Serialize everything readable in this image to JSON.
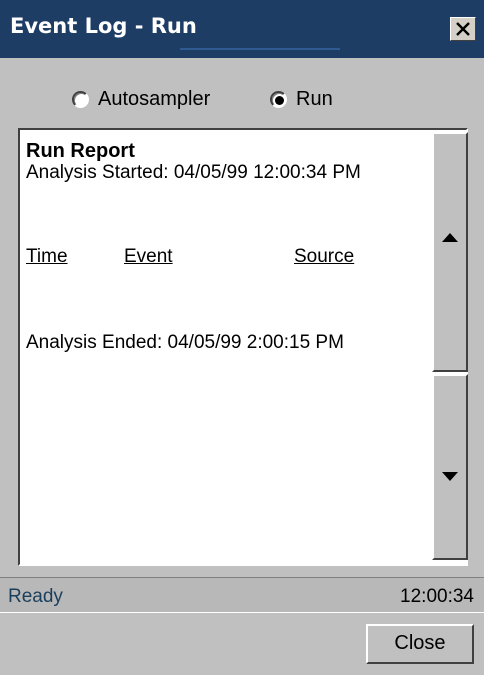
{
  "window": {
    "title": "Event Log - Run"
  },
  "view_options": {
    "autosampler_label": "Autosampler",
    "run_label": "Run",
    "selected": "Run"
  },
  "report": {
    "title": "Run Report",
    "started": "Analysis Started: 04/05/99  12:00:34 PM",
    "columns": {
      "time": "Time",
      "event": "Event",
      "source": "Source"
    },
    "ended": "Analysis Ended: 04/05/99  2:00:15 PM"
  },
  "status": {
    "text": "Ready",
    "time": "12:00:34"
  },
  "buttons": {
    "close": "Close"
  },
  "colors": {
    "titlebar": "#1e3d65",
    "window_bg": "#c0c0c0",
    "status_text": "#1a3f5c"
  },
  "icons": {
    "close": "close-icon",
    "scroll_up": "arrow-up-icon",
    "scroll_down": "arrow-down-icon"
  }
}
